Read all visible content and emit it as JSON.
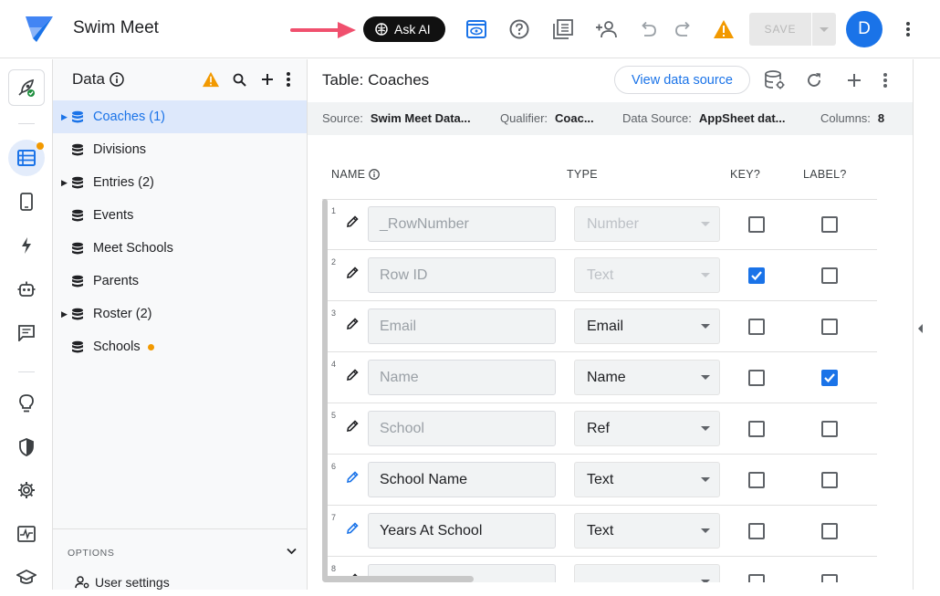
{
  "app": {
    "title": "Swim Meet"
  },
  "topbar": {
    "ask_ai_label": "Ask AI",
    "save_label": "SAVE",
    "avatar_initial": "D",
    "warning_color": "#f29900",
    "accent_color": "#1a73e8"
  },
  "data_panel": {
    "title": "Data",
    "tables": [
      {
        "label": "Coaches (1)",
        "expandable": true,
        "selected": true
      },
      {
        "label": "Divisions",
        "expandable": false
      },
      {
        "label": "Entries (2)",
        "expandable": true
      },
      {
        "label": "Events",
        "expandable": false
      },
      {
        "label": "Meet Schools",
        "expandable": false
      },
      {
        "label": "Parents",
        "expandable": false
      },
      {
        "label": "Roster (2)",
        "expandable": true
      },
      {
        "label": "Schools",
        "expandable": false,
        "unsaved_dot": true
      }
    ],
    "options_label": "OPTIONS",
    "user_settings_label": "User settings"
  },
  "main": {
    "table_title": "Table: Coaches",
    "view_source_label": "View data source",
    "meta": {
      "source_key": "Source:",
      "source_val": "Swim Meet Data...",
      "qualifier_key": "Qualifier:",
      "qualifier_val": "Coac...",
      "datasource_key": "Data Source:",
      "datasource_val": "AppSheet dat...",
      "columns_key": "Columns:",
      "columns_val": "8"
    },
    "headers": {
      "name": "NAME",
      "type": "TYPE",
      "key": "KEY?",
      "label": "LABEL?"
    },
    "rows": [
      {
        "num": "1",
        "name": "_RowNumber",
        "type": "Number",
        "key": false,
        "label": false,
        "editable": false,
        "type_disabled": true
      },
      {
        "num": "2",
        "name": "Row ID",
        "type": "Text",
        "key": true,
        "label": false,
        "editable": false,
        "type_disabled": true
      },
      {
        "num": "3",
        "name": "Email",
        "type": "Email",
        "key": false,
        "label": false,
        "editable": false,
        "type_disabled": false
      },
      {
        "num": "4",
        "name": "Name",
        "type": "Name",
        "key": false,
        "label": true,
        "editable": false,
        "type_disabled": false
      },
      {
        "num": "5",
        "name": "School",
        "type": "Ref",
        "key": false,
        "label": false,
        "editable": false,
        "type_disabled": false
      },
      {
        "num": "6",
        "name": "School Name",
        "type": "Text",
        "key": false,
        "label": false,
        "editable": true,
        "type_disabled": false
      },
      {
        "num": "7",
        "name": "Years At School",
        "type": "Text",
        "key": false,
        "label": false,
        "editable": true,
        "type_disabled": false
      },
      {
        "num": "8",
        "name": "",
        "type": "",
        "key": false,
        "label": false,
        "editable": false,
        "type_disabled": false
      }
    ]
  }
}
